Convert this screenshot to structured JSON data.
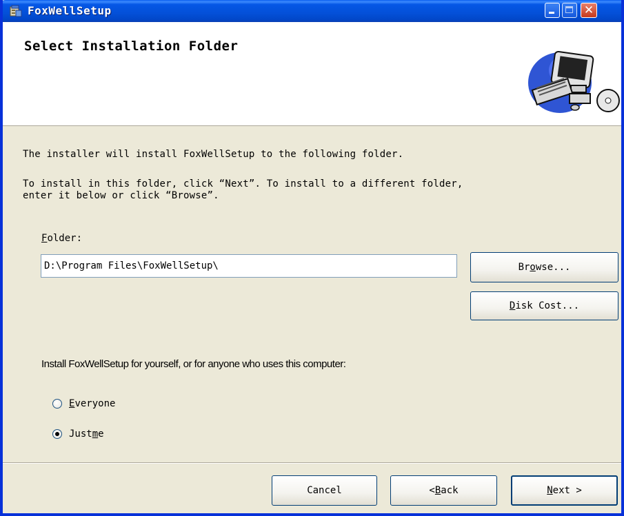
{
  "window": {
    "title": "FoxWellSetup"
  },
  "banner": {
    "title": "Select Installation Folder",
    "art_icon": "computer-icon"
  },
  "body": {
    "intro": "The installer will install FoxWellSetup to the following folder.",
    "instructions": "To install in this folder, click “Next”. To install to a different folder,\nenter it below or click “Browse”.",
    "folder_label_key": "F",
    "folder_label_rest": "older:",
    "folder_value": "D:\\Program Files\\FoxWellSetup\\"
  },
  "buttons": {
    "browse_pre": "Br",
    "browse_key": "o",
    "browse_post": "wse...",
    "disk_key": "D",
    "disk_post": "isk Cost...",
    "cancel": "Cancel",
    "back_pre": "< ",
    "back_key": "B",
    "back_post": "ack",
    "next_key": "N",
    "next_post": "ext >"
  },
  "install_for": {
    "prompt": "Install FoxWellSetup for yourself, or for anyone who uses this computer:",
    "options": [
      {
        "key": "E",
        "rest": "veryone",
        "selected": false
      },
      {
        "pre": "Just ",
        "key": "m",
        "rest": "e",
        "selected": true
      }
    ]
  },
  "colors": {
    "titlebar": "#0450d8",
    "dialog_bg": "#ece9d8",
    "banner_bg": "#ffffff",
    "button_border": "#003c74"
  }
}
